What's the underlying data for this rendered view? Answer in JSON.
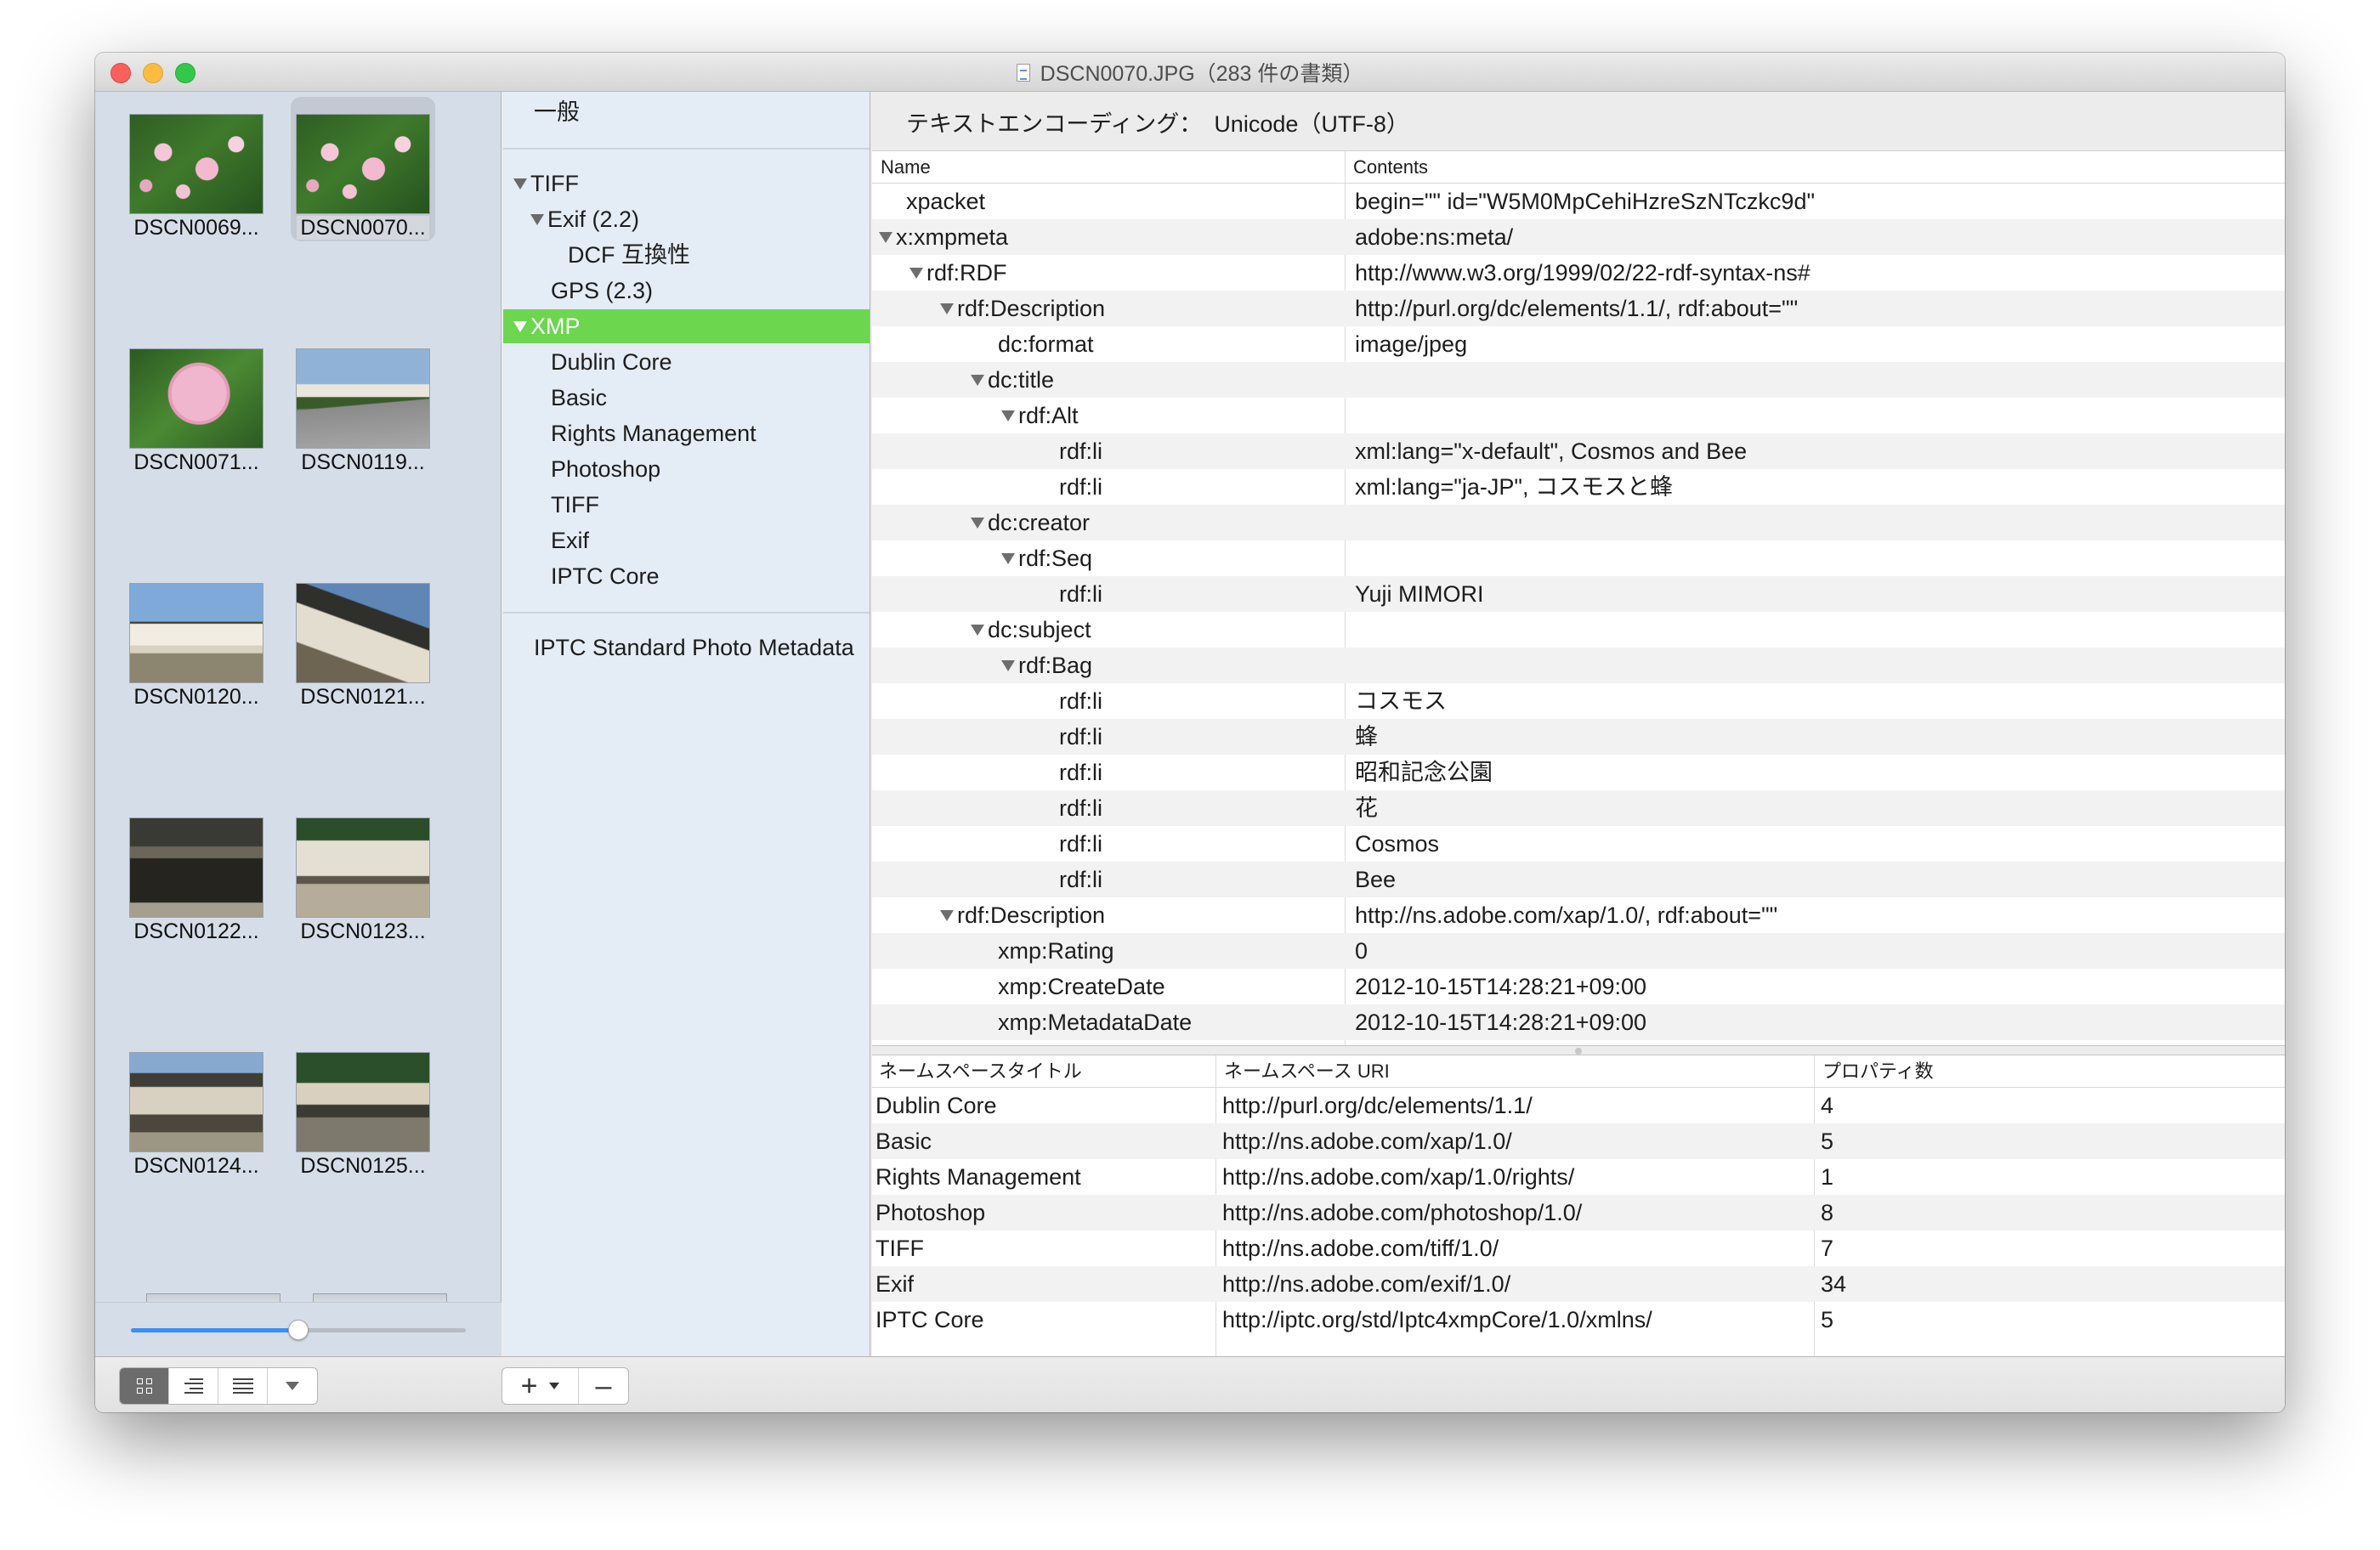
{
  "window": {
    "title": "DSCN0070.JPG（283 件の書類）"
  },
  "thumbnails": [
    {
      "label": "DSCN0069...",
      "photo": "pink cosmos flowers",
      "selected": false
    },
    {
      "label": "DSCN0070...",
      "photo": "pink cosmos flowers",
      "selected": true
    },
    {
      "label": "DSCN0071...",
      "photo": "single cosmos flower",
      "selected": false
    },
    {
      "label": "DSCN0119...",
      "photo": "road and building",
      "selected": false
    },
    {
      "label": "DSCN0120...",
      "photo": "castle wall",
      "selected": false
    },
    {
      "label": "DSCN0121...",
      "photo": "castle wall",
      "selected": false
    },
    {
      "label": "DSCN0122...",
      "photo": "gate",
      "selected": false
    },
    {
      "label": "DSCN0123...",
      "photo": "gate",
      "selected": false
    },
    {
      "label": "DSCN0124...",
      "photo": "gate",
      "selected": false
    },
    {
      "label": "DSCN0125...",
      "photo": "gate",
      "selected": false
    }
  ],
  "thumbnail_size_slider": {
    "value": 0.5
  },
  "categories": [
    {
      "label": "一般"
    },
    {
      "label": "TIFF"
    },
    {
      "label": "Exif (2.2)"
    },
    {
      "label": "DCF 互換性"
    },
    {
      "label": "GPS (2.3)"
    },
    {
      "label": "XMP",
      "selected": true
    },
    {
      "label": "Dublin Core"
    },
    {
      "label": "Basic"
    },
    {
      "label": "Rights Management"
    },
    {
      "label": "Photoshop"
    },
    {
      "label": "TIFF"
    },
    {
      "label": "Exif"
    },
    {
      "label": "IPTC Core"
    },
    {
      "label": "IPTC Standard Photo Metadata"
    }
  ],
  "encoding": {
    "label": "テキストエンコーディング：",
    "value": "Unicode（UTF-8）"
  },
  "xml_table": {
    "columns": [
      "Name",
      "Contents"
    ],
    "rows": [
      {
        "name": "xpacket",
        "contents": "begin=\"\" id=\"W5M0MpCehiHzreSzNTczkc9d\"",
        "expandable": false
      },
      {
        "name": "x:xmpmeta",
        "contents": "adobe:ns:meta/",
        "expandable": true
      },
      {
        "name": "rdf:RDF",
        "contents": "http://www.w3.org/1999/02/22-rdf-syntax-ns#",
        "expandable": true
      },
      {
        "name": "rdf:Description",
        "contents": "http://purl.org/dc/elements/1.1/, rdf:about=\"\"",
        "expandable": true
      },
      {
        "name": "dc:format",
        "contents": "image/jpeg",
        "expandable": false
      },
      {
        "name": "dc:title",
        "contents": "",
        "expandable": true
      },
      {
        "name": "rdf:Alt",
        "contents": "",
        "expandable": true
      },
      {
        "name": "rdf:li",
        "contents": "xml:lang=\"x-default\", Cosmos and Bee",
        "expandable": false
      },
      {
        "name": "rdf:li",
        "contents": "xml:lang=\"ja-JP\", コスモスと蜂",
        "expandable": false
      },
      {
        "name": "dc:creator",
        "contents": "",
        "expandable": true
      },
      {
        "name": "rdf:Seq",
        "contents": "",
        "expandable": true
      },
      {
        "name": "rdf:li",
        "contents": "Yuji MIMORI",
        "expandable": false
      },
      {
        "name": "dc:subject",
        "contents": "",
        "expandable": true
      },
      {
        "name": "rdf:Bag",
        "contents": "",
        "expandable": true
      },
      {
        "name": "rdf:li",
        "contents": "コスモス",
        "expandable": false
      },
      {
        "name": "rdf:li",
        "contents": "蜂",
        "expandable": false
      },
      {
        "name": "rdf:li",
        "contents": "昭和記念公園",
        "expandable": false
      },
      {
        "name": "rdf:li",
        "contents": "花",
        "expandable": false
      },
      {
        "name": "rdf:li",
        "contents": "Cosmos",
        "expandable": false
      },
      {
        "name": "rdf:li",
        "contents": "Bee",
        "expandable": false
      },
      {
        "name": "rdf:Description",
        "contents": "http://ns.adobe.com/xap/1.0/, rdf:about=\"\"",
        "expandable": true
      },
      {
        "name": "xmp:Rating",
        "contents": "0",
        "expandable": false
      },
      {
        "name": "xmp:CreateDate",
        "contents": "2012-10-15T14:28:21+09:00",
        "expandable": false
      },
      {
        "name": "xmp:MetadataDate",
        "contents": "2012-10-15T14:28:21+09:00",
        "expandable": false
      }
    ]
  },
  "namespace_table": {
    "columns": [
      "ネームスペースタイトル",
      "ネームスペース URI",
      "プロパティ数"
    ],
    "rows": [
      {
        "title": "Dublin Core",
        "uri": "http://purl.org/dc/elements/1.1/",
        "count": "4"
      },
      {
        "title": "Basic",
        "uri": "http://ns.adobe.com/xap/1.0/",
        "count": "5"
      },
      {
        "title": "Rights Management",
        "uri": "http://ns.adobe.com/xap/1.0/rights/",
        "count": "1"
      },
      {
        "title": "Photoshop",
        "uri": "http://ns.adobe.com/photoshop/1.0/",
        "count": "8"
      },
      {
        "title": "TIFF",
        "uri": "http://ns.adobe.com/tiff/1.0/",
        "count": "7"
      },
      {
        "title": "Exif",
        "uri": "http://ns.adobe.com/exif/1.0/",
        "count": "34"
      },
      {
        "title": "IPTC Core",
        "uri": "http://iptc.org/std/Iptc4xmpCore/1.0/xmlns/",
        "count": "5"
      }
    ]
  },
  "toolbar": {
    "view_buttons": [
      "grid-view-icon",
      "outline-view-icon",
      "list-view-icon",
      "view-options-icon"
    ],
    "add_label": "+",
    "remove_label": "–"
  }
}
